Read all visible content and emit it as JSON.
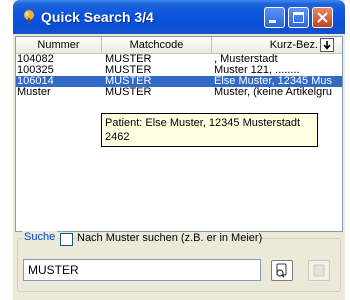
{
  "window": {
    "title": "Quick Search 3/4",
    "icons": {
      "app": "tree-icon",
      "minimize": "minimize-icon",
      "maximize": "maximize-icon",
      "close": "close-icon"
    }
  },
  "list": {
    "columns": [
      "Nummer",
      "Matchcode",
      "Kurz-Bez."
    ],
    "sort_icon": "arrow-down-icon",
    "rows": [
      {
        "nummer": "104082",
        "matchcode": "MUSTER",
        "kurzbez": ", Musterstadt",
        "selected": false
      },
      {
        "nummer": "100325",
        "matchcode": "MUSTER",
        "kurzbez": "Muster 121, ........",
        "selected": false
      },
      {
        "nummer": "106014",
        "matchcode": "MUSTER",
        "kurzbez": "Else Muster, 12345 Mus",
        "selected": true
      },
      {
        "nummer": "Muster",
        "matchcode": "MUSTER",
        "kurzbez": "Muster, (keine Artikelgru",
        "selected": false
      }
    ]
  },
  "tooltip": {
    "line1": "Patient: Else Muster, 12345 Musterstadt",
    "line2": "2462"
  },
  "search": {
    "legend": "Suche",
    "checkbox_label": "Nach Muster suchen (z.B. er in Meier)",
    "checkbox_checked": false,
    "input_value": "MUSTER",
    "search_icon": "search-binoculars-icon",
    "ok_icon": "ok-icon"
  },
  "colors": {
    "selection": "#316ac5",
    "title_bar": "#0b54e0",
    "tooltip_bg": "#ffffe1",
    "legend": "#0046d5"
  }
}
